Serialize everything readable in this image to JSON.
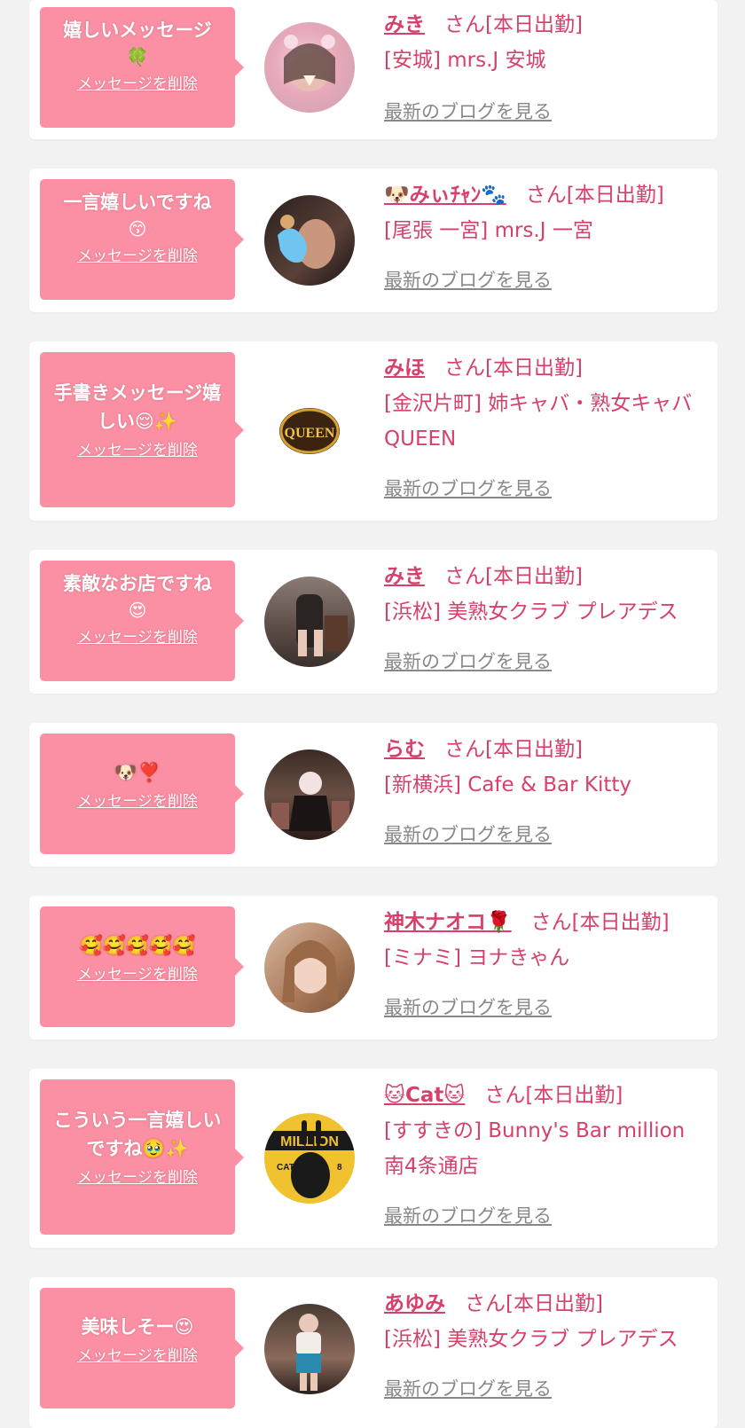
{
  "entries": [
    {
      "message": "嬉しいメッセージ",
      "message_emoji": "🍀",
      "delete_label": "メッセージを削除",
      "name": "みき",
      "name_suffix": "さん[本日出勤]",
      "shop": "[安城] mrs.J 安城",
      "blog_label": "最新のブログを見る",
      "avatar_icon": "avatar-photo-icon"
    },
    {
      "message": "一言嬉しいですね",
      "message_emoji": "😙",
      "delete_label": "メッセージを削除",
      "name": "🐶みぃﾁｬﾝ🐾",
      "name_suffix": "さん[本日出勤]",
      "shop": "[尾張 一宮] mrs.J 一宮",
      "blog_label": "最新のブログを見る",
      "avatar_icon": "avatar-photo-icon"
    },
    {
      "message": "手書きメッセージ嬉しい😌✨",
      "message_emoji": "",
      "delete_label": "メッセージを削除",
      "name": "みほ",
      "name_suffix": "さん[本日出勤]",
      "shop": "[金沢片町] 姉キャバ・熟女キャバ QUEEN",
      "blog_label": "最新のブログを見る",
      "avatar_icon": "queen-logo-icon"
    },
    {
      "message": "素敵なお店ですね",
      "message_emoji": "😍",
      "delete_label": "メッセージを削除",
      "name": "みき",
      "name_suffix": "さん[本日出勤]",
      "shop": "[浜松] 美熟女クラブ プレアデス",
      "blog_label": "最新のブログを見る",
      "avatar_icon": "avatar-photo-icon"
    },
    {
      "message": "🐶❣️",
      "message_emoji": "",
      "delete_label": "メッセージを削除",
      "name": "らむ",
      "name_suffix": "さん[本日出勤]",
      "shop": "[新横浜] Cafe & Bar Kitty",
      "blog_label": "最新のブログを見る",
      "avatar_icon": "avatar-photo-icon"
    },
    {
      "message": "🥰🥰🥰🥰🥰",
      "message_emoji": "",
      "delete_label": "メッセージを削除",
      "name": "神木ナオコ🌹",
      "name_suffix": "さん[本日出勤]",
      "shop": "[ミナミ] ヨナきゃん",
      "blog_label": "最新のブログを見る",
      "avatar_icon": "avatar-photo-icon"
    },
    {
      "message": "こういう一言嬉しいですね🥹✨",
      "message_emoji": "",
      "delete_label": "メッセージを削除",
      "name": "🐱Cat🐱",
      "name_suffix": "さん[本日出勤]",
      "shop": "[すすきの] Bunny's Bar million 南4条通店",
      "blog_label": "最新のブログを見る",
      "avatar_icon": "avatar-photo-icon"
    },
    {
      "message": "美味しそー😍",
      "message_emoji": "",
      "delete_label": "メッセージを削除",
      "name": "あゆみ",
      "name_suffix": "さん[本日出勤]",
      "shop": "[浜松] 美熟女クラブ プレアデス",
      "blog_label": "最新のブログを見る",
      "avatar_icon": "avatar-photo-icon"
    }
  ],
  "colors": {
    "bubble": "#fb8fa3",
    "accent": "#d6416b",
    "link_gray": "#888888",
    "background": "#f2f2f2"
  }
}
